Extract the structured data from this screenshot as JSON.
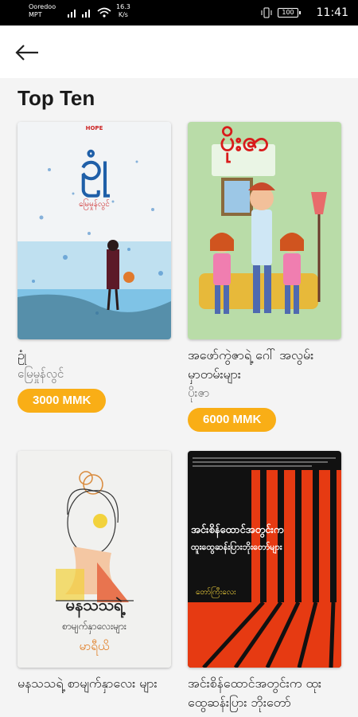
{
  "status_bar": {
    "carrier": "Ooredoo MPT",
    "net_speed_value": "16.3",
    "net_speed_unit": "K/s",
    "battery": "100",
    "time": "11:41"
  },
  "app_bar": {
    "back_icon": "arrow-left-icon"
  },
  "section": {
    "title": "Top Ten"
  },
  "books": [
    {
      "title": "ဥုံ",
      "author": "မြေမှုန်လွင်",
      "price": "3000 MMK",
      "cover": {
        "publisher_logo": "HOPE",
        "headline": "ဥုံ",
        "byline": "မြေမှုန်လွင်",
        "accent": "#1f5fa8"
      }
    },
    {
      "title": "အဖော်ကွဲဇာရဲ့ ဂေါ် အလွမ်းမှာတမ်းများ",
      "author": "ပိုးဇာ",
      "price": "6000 MMK",
      "cover": {
        "headline": "ပိုးဇာ",
        "accent": "#d81b1b"
      }
    },
    {
      "title": "မနသသရဲ့ စာမျက်နှာလေး များ",
      "author": "",
      "price": "",
      "cover": {
        "headline": "မနသသရဲ့",
        "subline": "စာမျက်နှာလေးများ",
        "byline": "မာရီယိ"
      }
    },
    {
      "title": "အင်းစိန်ထောင်အတွင်းက ထုးထွေဆန်းပြား ဘိုးတော်",
      "author": "",
      "price": "",
      "cover": {
        "headline": "အင်းစိန်ထောင်အတွင်းက",
        "subline": "ထူးထွေဆန်းပြားဘိုးတော်များ",
        "byline": "တော်ကြီးလေး",
        "accent": "#e63a12"
      }
    }
  ],
  "colors": {
    "price_badge": "#f9ae16",
    "background": "#f4f4f4"
  }
}
